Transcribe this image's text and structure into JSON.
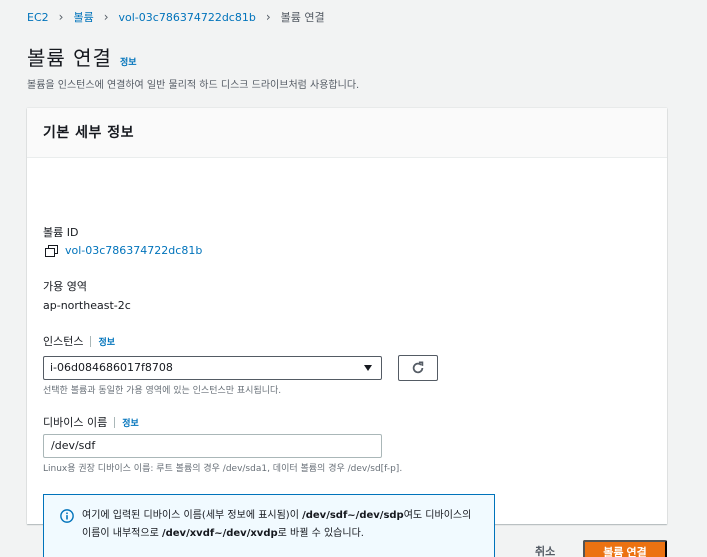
{
  "breadcrumb": {
    "items": [
      "EC2",
      "볼륨",
      "vol-03c786374722dc81b"
    ],
    "current": "볼륨 연결"
  },
  "page": {
    "title": "볼륨 연결",
    "info": "정보",
    "description": "볼륨을 인스턴스에 연결하여 일반 물리적 하드 디스크 드라이브처럼 사용합니다."
  },
  "card": {
    "title": "기본 세부 정보",
    "volume_id_label": "볼륨 ID",
    "volume_id": "vol-03c786374722dc81b",
    "az_label": "가용 영역",
    "az_value": "ap-northeast-2c",
    "instance_label": "인스턴스",
    "instance_info": "정보",
    "instance_value": "i-06d084686017f8708",
    "instance_hint": "선택한 볼륨과 동일한 가용 영역에 있는 인스턴스만 표시됩니다.",
    "device_label": "디바이스 이름",
    "device_info": "정보",
    "device_value": "/dev/sdf",
    "device_hint": "Linux용 권장 디바이스 이름: 루트 볼륨의 경우 /dev/sda1, 데이터 볼륨의 경우 /dev/sd[f-p].",
    "alert": {
      "part1": "여기에 입력된 디바이스 이름(세부 정보에 표시됨)이 ",
      "bold1": "/dev/sdf~/dev/sdp",
      "part2": "여도 디바이스의 이름이 내부적으로 ",
      "bold2": "/dev/xvdf~/dev/xvdp",
      "part3": "로 바뀔 수 있습니다."
    }
  },
  "footer": {
    "cancel": "취소",
    "submit": "볼륨 연결"
  },
  "colors": {
    "link": "#0073bb",
    "primary": "#ec7211",
    "alert_bg": "#f1faff"
  }
}
